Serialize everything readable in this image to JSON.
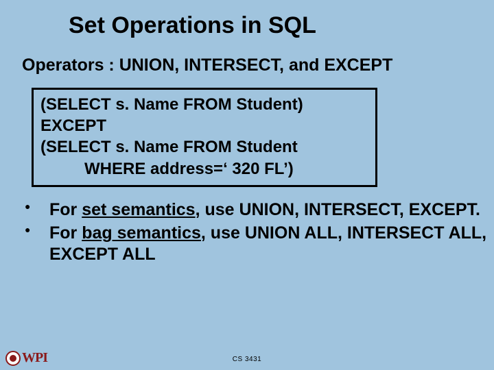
{
  "title": "Set Operations in SQL",
  "subtitle": "Operators : UNION,  INTERSECT, and  EXCEPT",
  "code": {
    "line1": "(SELECT s. Name FROM Student)",
    "line2": "EXCEPT",
    "line3": "(SELECT s. Name FROM Student",
    "line4": "WHERE address=‘ 320 FL’)"
  },
  "bullets": {
    "b1_pre": "For ",
    "b1_u": "set semantics",
    "b1_post": ", use UNION, INTERSECT, EXCEPT.",
    "b2_pre": "For ",
    "b2_u": "bag semantics",
    "b2_post": ", use UNION ALL, INTERSECT ALL, EXCEPT ALL"
  },
  "footer": "CS 3431",
  "logo_text": "WPI"
}
